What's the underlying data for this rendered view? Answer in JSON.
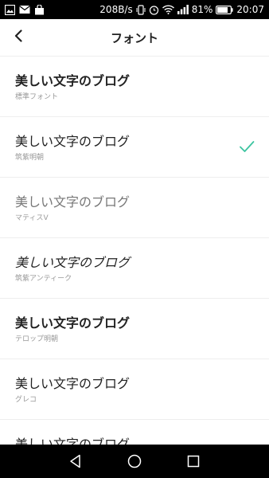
{
  "status_bar": {
    "speed": "208B/s",
    "battery_percent": "81%",
    "time": "20:07",
    "battery_level": 0.81
  },
  "header": {
    "title": "フォント"
  },
  "fonts": [
    {
      "sample": "美しい文字のブログ",
      "name": "標準フォント",
      "selected": false
    },
    {
      "sample": "美しい文字のブログ",
      "name": "筑紫明朝",
      "selected": true
    },
    {
      "sample": "美しい文字のブログ",
      "name": "マティスV",
      "selected": false
    },
    {
      "sample": "美しい文字のブログ",
      "name": "筑紫アンティーク",
      "selected": false
    },
    {
      "sample": "美しい文字のブログ",
      "name": "テロップ明朝",
      "selected": false
    },
    {
      "sample": "美しい文字のブログ",
      "name": "グレコ",
      "selected": false
    },
    {
      "sample": "美しい文字のブログ",
      "name": "",
      "selected": false
    }
  ],
  "colors": {
    "accent_check": "#3cc4a0",
    "status_bar_bg": "#000000",
    "nav_bar_bg": "#000000"
  }
}
